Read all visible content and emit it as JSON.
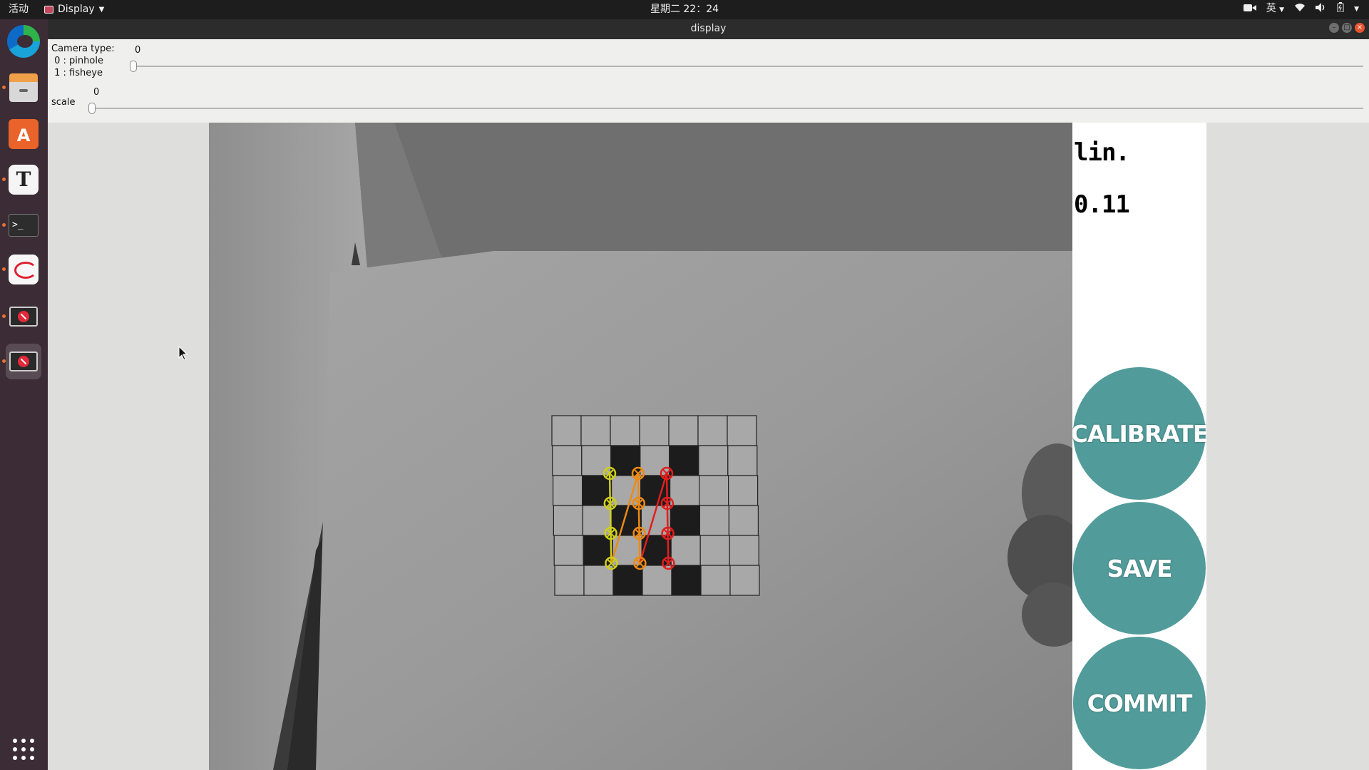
{
  "topbar": {
    "activities": "活动",
    "app_menu": "Display",
    "clock": "星期二 22：24",
    "input_method": "英",
    "tray_icons": [
      "camera-icon",
      "wifi-icon",
      "volume-icon",
      "battery-icon",
      "system-menu-icon"
    ]
  },
  "dock": {
    "items": [
      "edge-browser-icon",
      "files-icon",
      "software-store-icon",
      "text-editor-icon",
      "terminal-icon",
      "document-reader-icon",
      "display-app-icon",
      "display-app-icon"
    ]
  },
  "window": {
    "title": "display"
  },
  "controls": {
    "camera_type_label": "Camera type:\n 0 : pinhole\n 1 : fisheye",
    "camera_type_value": "0",
    "camera_type_level": 0,
    "scale_label": "scale",
    "scale_value": "0",
    "scale_level": 0
  },
  "panel": {
    "metric_label": "lin.",
    "metric_value": "0.11",
    "calibrate_label": "CALIBRATE",
    "save_label": "SAVE",
    "commit_label": "COMMIT",
    "button_color": "#519c9b"
  },
  "camera_view": {
    "checkerboard": {
      "rows": 6,
      "cols": 7
    },
    "detected_corner_columns": 3,
    "detected_corner_rows": 4,
    "overlay_colors": [
      "#cfcf1a",
      "#ee8a12",
      "#e11f1f"
    ]
  }
}
